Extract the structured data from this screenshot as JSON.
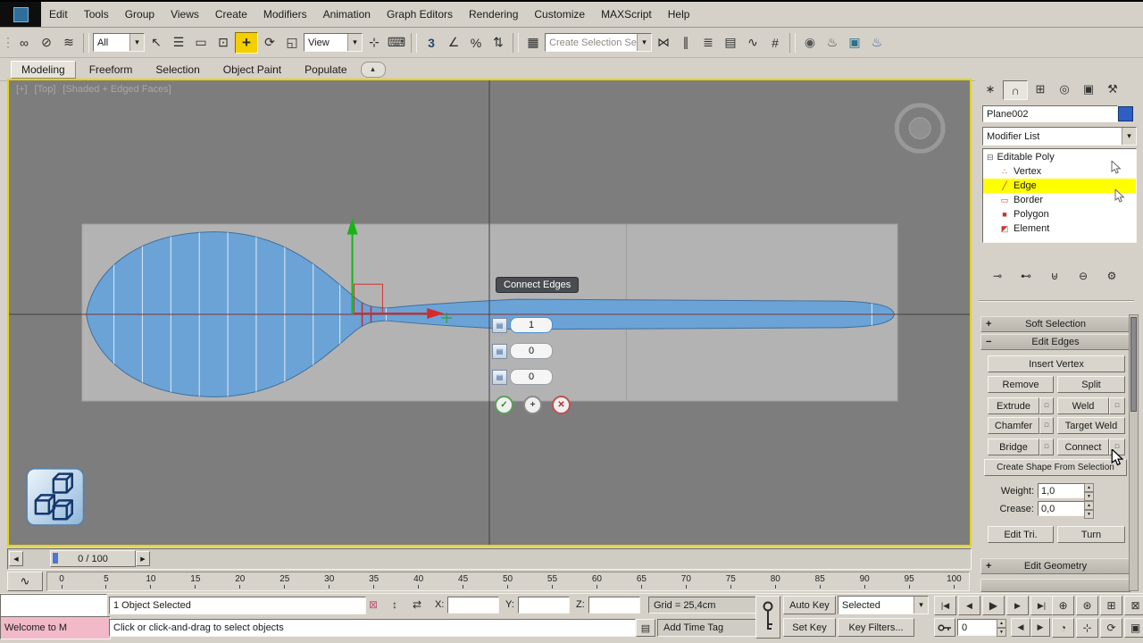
{
  "menubar": {
    "items": [
      "Edit",
      "Tools",
      "Group",
      "Views",
      "Create",
      "Modifiers",
      "Animation",
      "Graph Editors",
      "Rendering",
      "Customize",
      "MAXScript",
      "Help"
    ]
  },
  "toolbar": {
    "selection_filter": "All",
    "view": "View",
    "named_selection": "Create Selection Se"
  },
  "ribbon": {
    "tabs": [
      "Modeling",
      "Freeform",
      "Selection",
      "Object Paint",
      "Populate"
    ]
  },
  "viewport": {
    "label_plus": "[+]",
    "label_view": "[Top]",
    "label_shading": "[Shaded + Edged Faces]"
  },
  "caddy": {
    "title": "Connect Edges",
    "segments": "1",
    "pinch": "0",
    "slide": "0"
  },
  "panel": {
    "object_name": "Plane002",
    "modifier_list": "Modifier List",
    "stack": [
      "Editable Poly",
      "Vertex",
      "Edge",
      "Border",
      "Polygon",
      "Element"
    ],
    "soft_selection": "Soft Selection",
    "edit_edges": "Edit Edges",
    "insert_vertex": "Insert Vertex",
    "remove": "Remove",
    "split": "Split",
    "extrude": "Extrude",
    "weld": "Weld",
    "chamfer": "Chamfer",
    "target_weld": "Target Weld",
    "bridge": "Bridge",
    "connect": "Connect",
    "create_shape": "Create Shape From Selection",
    "weight_label": "Weight:",
    "weight": "1,0",
    "crease_label": "Crease:",
    "crease": "0,0",
    "edit_tri": "Edit Tri.",
    "turn": "Turn",
    "edit_geometry": "Edit Geometry"
  },
  "timeline": {
    "slider": "0 / 100",
    "ticks": [
      "0",
      "5",
      "10",
      "15",
      "20",
      "25",
      "30",
      "35",
      "40",
      "45",
      "50",
      "55",
      "60",
      "65",
      "70",
      "75",
      "80",
      "85",
      "90",
      "95",
      "100"
    ]
  },
  "status": {
    "selection": "1 Object Selected",
    "x": "X:",
    "y": "Y:",
    "z": "Z:",
    "grid": "Grid = 25,4cm",
    "auto_key": "Auto Key",
    "selected": "Selected",
    "set_key": "Set Key",
    "key_filters": "Key Filters...",
    "frame": "0",
    "add_time_tag": "Add Time Tag",
    "prompt": "Click or click-and-drag to select objects",
    "listener": "Welcome to M"
  },
  "colors": {
    "accent_yellow": "#f3cf00",
    "edge_highlight": "#ffff00",
    "object_blue": "#6ba3d6",
    "swatch_blue": "#2e5fc4"
  },
  "icons": {
    "chevron": "▾",
    "grip": "⋮",
    "link": "∞",
    "unlink": "⊘",
    "bind": "≋",
    "select": "↖",
    "by_name": "☰",
    "region": "▭",
    "crossing": "⊡",
    "move": "+",
    "rotate": "⟳",
    "scale": "◱",
    "manipulate": "⊹",
    "keyboard": "⌨",
    "snap": "3",
    "angle_snap": "∠",
    "percent_snap": "%",
    "spinner_snap": "⇅",
    "named_sets": "▦",
    "mirror": "⋈",
    "align": "∥",
    "layers": "≣",
    "ribbon_tools": "▤",
    "curve_editor": "∿",
    "schematic": "#",
    "material": "◉",
    "render_setup": "♨",
    "render_frame": "▣",
    "render": "♨",
    "tab_create": "∗",
    "tab_modify": "∩",
    "tab_hierarchy": "⊞",
    "tab_motion": "◎",
    "tab_display": "▣",
    "tab_utilities": "⚒",
    "pin": "⊸",
    "end_result": "⊷",
    "unique": "⊎",
    "remove_mod": "⊖",
    "configure": "⚙",
    "expand": "⊟",
    "sub_vertex": "∴",
    "sub_edge": "╱",
    "sub_border": "▭",
    "sub_polygon": "■",
    "sub_element": "◩",
    "settings_box": "□",
    "caddy_field": "▤",
    "ok": "✓",
    "apply": "+",
    "cancel": "✕",
    "left": "◀",
    "right": "▶",
    "up": "▲",
    "down": "▼",
    "go_start": "|◀",
    "prev_frame": "◀",
    "play": "▶",
    "next_frame": "▶",
    "go_end": "▶|",
    "zoom": "⊕",
    "zoom_all": "⊛",
    "zoom_extents": "⊞",
    "zoom_region": "⊠",
    "fov": "◔",
    "pan": "⊹",
    "orbit": "⟳",
    "maximize": "▣",
    "lock": "⊠",
    "absolute_mode": "↕",
    "offset_mode": "⇄",
    "time_tag": "▤",
    "ribbon_collapse": "▴"
  }
}
